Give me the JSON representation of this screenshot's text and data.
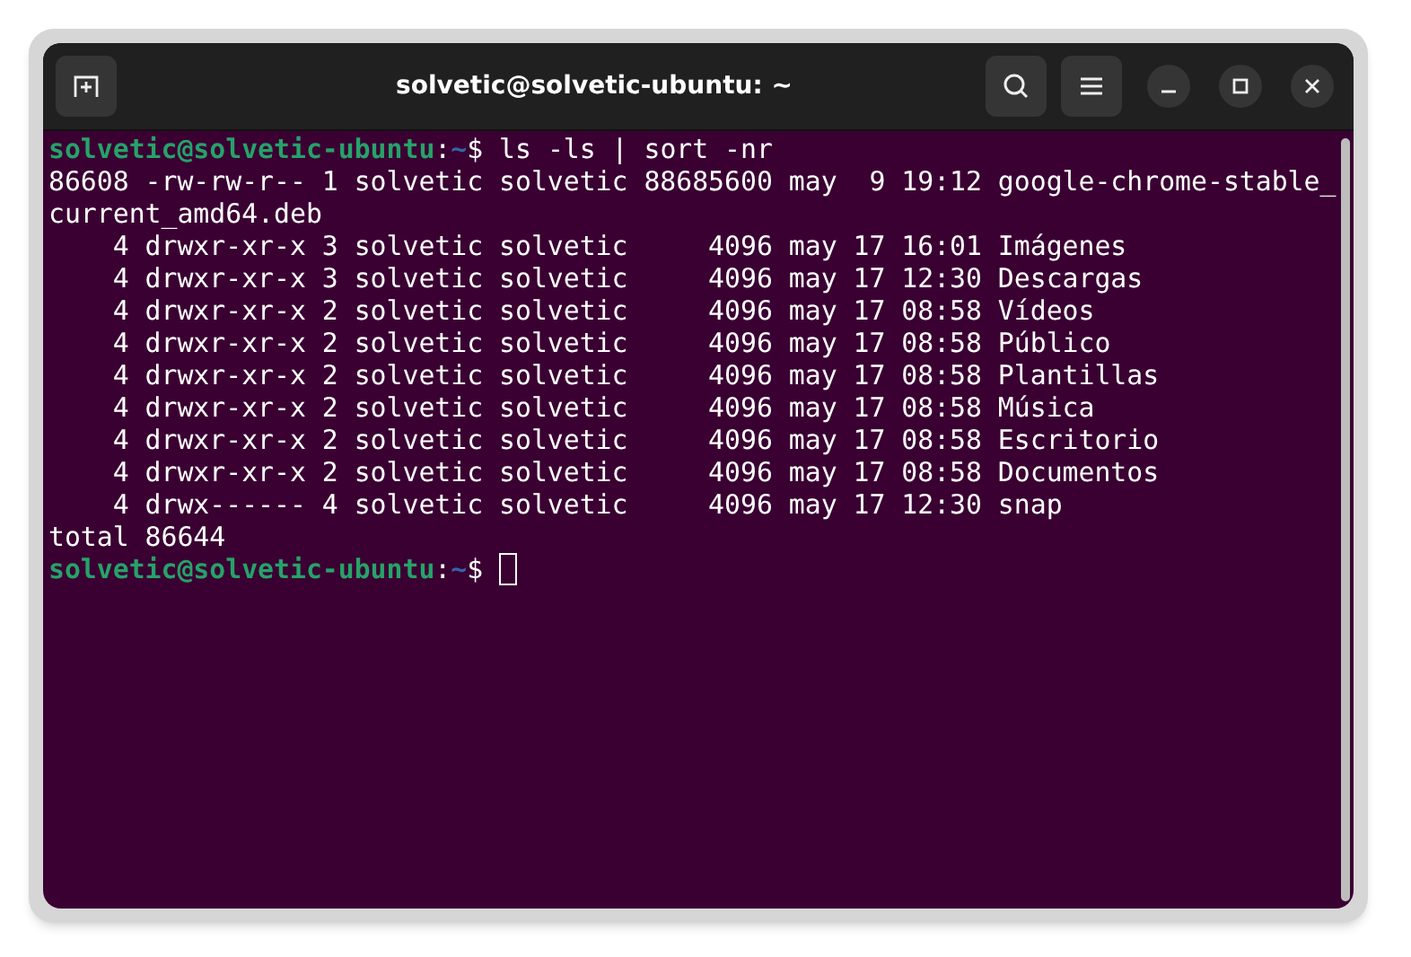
{
  "window": {
    "title": "solvetic@solvetic-ubuntu: ~"
  },
  "terminal": {
    "lines": [
      {
        "kind": "prompt",
        "user_host": "solvetic@solvetic-ubuntu",
        "separator": ":",
        "path": "~",
        "symbol": "$",
        "command": " ls -ls | sort -nr",
        "cursor": false
      },
      {
        "kind": "output",
        "text": "86608 -rw-rw-r-- 1 solvetic solvetic 88685600 may  9 19:12 google-chrome-stable_"
      },
      {
        "kind": "output",
        "text": "current_amd64.deb"
      },
      {
        "kind": "output",
        "text": "    4 drwxr-xr-x 3 solvetic solvetic     4096 may 17 16:01 Imágenes"
      },
      {
        "kind": "output",
        "text": "    4 drwxr-xr-x 3 solvetic solvetic     4096 may 17 12:30 Descargas"
      },
      {
        "kind": "output",
        "text": "    4 drwxr-xr-x 2 solvetic solvetic     4096 may 17 08:58 Vídeos"
      },
      {
        "kind": "output",
        "text": "    4 drwxr-xr-x 2 solvetic solvetic     4096 may 17 08:58 Público"
      },
      {
        "kind": "output",
        "text": "    4 drwxr-xr-x 2 solvetic solvetic     4096 may 17 08:58 Plantillas"
      },
      {
        "kind": "output",
        "text": "    4 drwxr-xr-x 2 solvetic solvetic     4096 may 17 08:58 Música"
      },
      {
        "kind": "output",
        "text": "    4 drwxr-xr-x 2 solvetic solvetic     4096 may 17 08:58 Escritorio"
      },
      {
        "kind": "output",
        "text": "    4 drwxr-xr-x 2 solvetic solvetic     4096 may 17 08:58 Documentos"
      },
      {
        "kind": "output",
        "text": "    4 drwx------ 4 solvetic solvetic     4096 may 17 12:30 snap"
      },
      {
        "kind": "output",
        "text": "total 86644"
      },
      {
        "kind": "prompt",
        "user_host": "solvetic@solvetic-ubuntu",
        "separator": ":",
        "path": "~",
        "symbol": "$",
        "cursor": true
      }
    ]
  }
}
